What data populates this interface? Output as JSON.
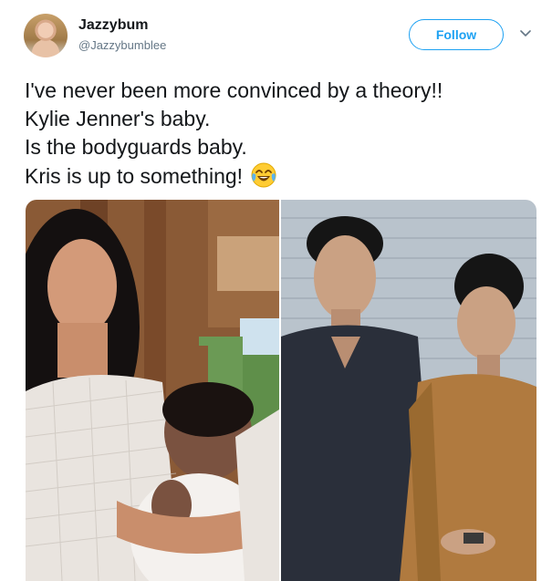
{
  "tweet": {
    "display_name": "Jazzybum",
    "handle": "@Jazzybumblee",
    "follow_label": "Follow",
    "lines": [
      "I've never been more convinced by a theory!!",
      "Kylie Jenner's baby.",
      "Is the bodyguards baby.",
      "Kris is up to something!"
    ],
    "emoji": "face-with-tears-of-joy-icon"
  },
  "colors": {
    "accent": "#1da1f2",
    "text": "#14171a",
    "secondary": "#657786"
  },
  "icons": {
    "menu": "chevron-down-icon"
  }
}
